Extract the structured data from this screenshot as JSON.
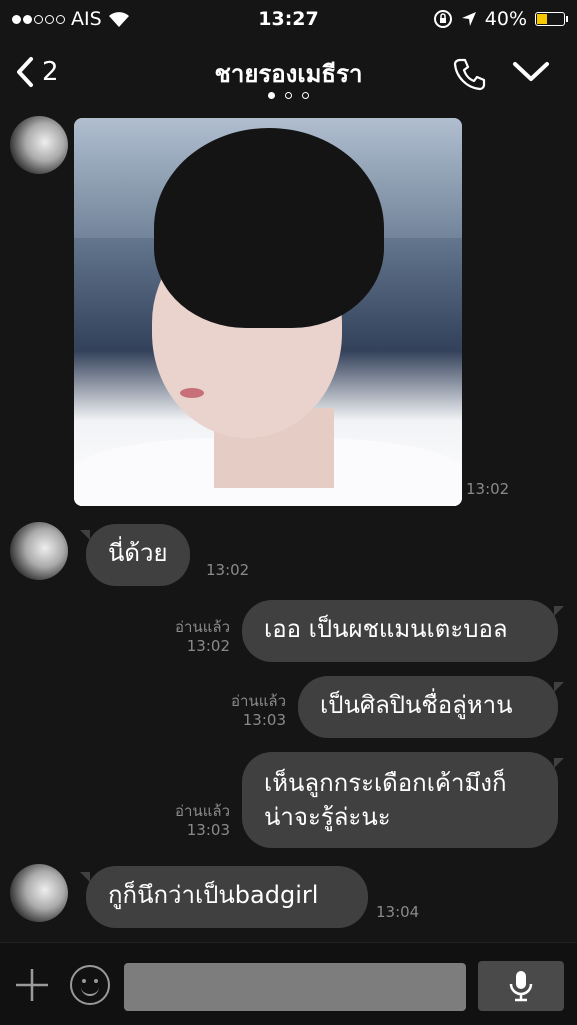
{
  "status_bar": {
    "carrier": "AIS",
    "time": "13:27",
    "battery": "40%",
    "battery_level": 0.4,
    "signal_bars": 2,
    "signal_total": 5
  },
  "header": {
    "back_count": "2",
    "title": "ชายรองเมธีรา",
    "page_dots": 3,
    "active_page": 0
  },
  "messages": [
    {
      "id": "m1",
      "type": "image",
      "direction": "in",
      "time": "13:02"
    },
    {
      "id": "m2",
      "type": "text",
      "direction": "in",
      "text": "นี่ด้วย",
      "time": "13:02"
    },
    {
      "id": "m3",
      "type": "text",
      "direction": "out",
      "text": "เออ เป็นผชแมนเตะบอล",
      "read": "อ่านแล้ว",
      "time": "13:02"
    },
    {
      "id": "m4",
      "type": "text",
      "direction": "out",
      "text": "เป็นศิลปินชื่อลู่หาน",
      "read": "อ่านแล้ว",
      "time": "13:03"
    },
    {
      "id": "m5",
      "type": "text",
      "direction": "out",
      "line1": "เห็นลูกกระเดือกเค้ามึงก็",
      "line2": "น่าจะรู้ล่ะนะ",
      "read": "อ่านแล้ว",
      "time": "13:03"
    },
    {
      "id": "m6",
      "type": "text",
      "direction": "in",
      "text": "กูก็นึกว่าเป็นbadgirl",
      "time": "13:04"
    }
  ],
  "input_bar": {
    "placeholder": ""
  }
}
